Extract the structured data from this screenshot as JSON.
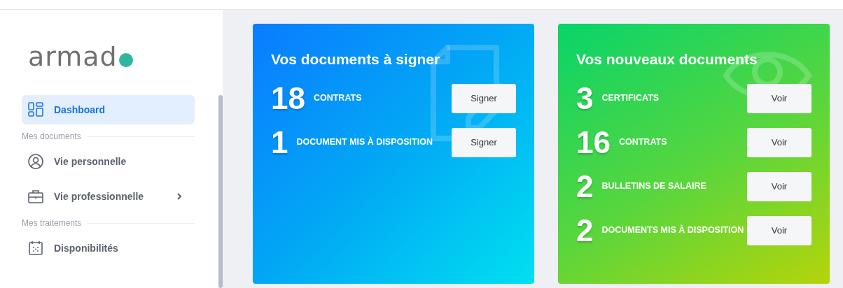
{
  "logo": {
    "text": "armad"
  },
  "sidebar": {
    "items": [
      {
        "kind": "item",
        "label": "Dashboard",
        "selected": true,
        "has_submenu": false
      },
      {
        "kind": "heading",
        "label": "Mes documents"
      },
      {
        "kind": "item",
        "label": "Vie personnelle",
        "selected": false,
        "has_submenu": false
      },
      {
        "kind": "item",
        "label": "Vie professionnelle",
        "selected": false,
        "has_submenu": true
      },
      {
        "kind": "heading",
        "label": "Mes traitements"
      },
      {
        "kind": "item",
        "label": "Disponibilités",
        "selected": false,
        "has_submenu": false
      }
    ]
  },
  "cards": [
    {
      "kind": "sign",
      "title": "Vos documents à signer",
      "rows": [
        {
          "count": "18",
          "label": "CONTRATS",
          "button": "Signer"
        },
        {
          "count": "1",
          "label": "DOCUMENT MIS À DISPOSITION",
          "button": "Signer"
        }
      ]
    },
    {
      "kind": "new",
      "title": "Vos nouveaux documents",
      "rows": [
        {
          "count": "3",
          "label": "CERTIFICATS",
          "button": "Voir"
        },
        {
          "count": "16",
          "label": "CONTRATS",
          "button": "Voir"
        },
        {
          "count": "2",
          "label": "BULLETINS DE SALAIRE",
          "button": "Voir"
        },
        {
          "count": "2",
          "label": "DOCUMENTS MIS À DISPOSITION",
          "button": "Voir"
        }
      ]
    }
  ]
}
